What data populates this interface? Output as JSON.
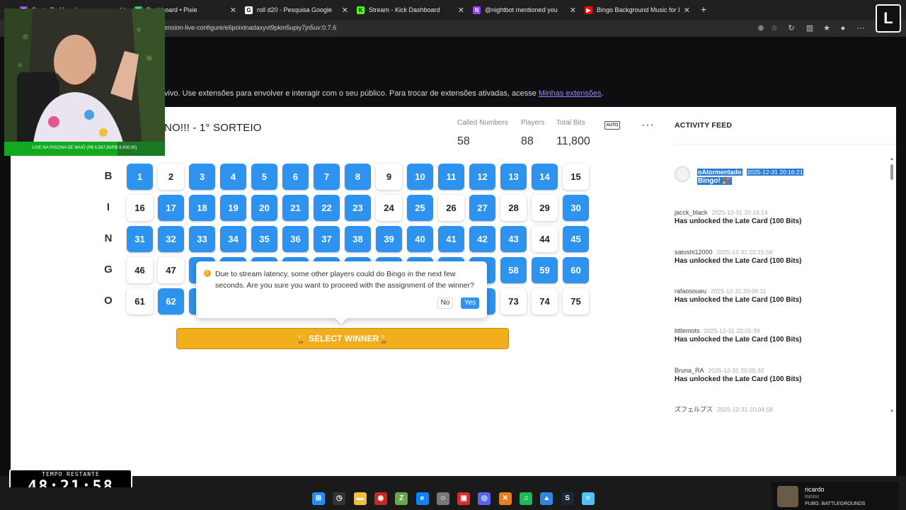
{
  "browser": {
    "tabs": [
      {
        "label": "Santa Pe Vaso Ia",
        "icon": "twitch-icon",
        "color": "#9146ff"
      },
      {
        "label": "Dashboard • Pixie",
        "icon": "pixie-icon",
        "color": "#22c55e"
      },
      {
        "label": "roll d20 - Pesquisa Google",
        "icon": "google-icon",
        "color": "#ffffff"
      },
      {
        "label": "Stream - Kick Dashboard",
        "icon": "kick-icon",
        "color": "#53fc18"
      },
      {
        "label": "@nightbot mentioned you",
        "icon": "nightbot-icon",
        "color": "#9146ff"
      },
      {
        "label": "Bingo Background Music for I",
        "icon": "youtube-icon",
        "color": "#ff0000"
      }
    ],
    "url": "ension-live-configure/e6poixtnadaxyvt9pkm5upiy7jn5uv:0.7.6"
  },
  "dashboard": {
    "subtitle_text": "vivo. Use extensões para envolver e interagir com o seu público. Para trocar de extensões ativadas, acesse ",
    "subtitle_link": "Minhas extensões",
    "subtitle_end": "."
  },
  "bingo": {
    "title": "NO!!! - 1° SORTEIO",
    "stats": [
      {
        "label": "Called Numbers",
        "value": "58"
      },
      {
        "label": "Players",
        "value": "88"
      },
      {
        "label": "Total Bits",
        "value": "11,800"
      }
    ],
    "auto_label": "AUTO",
    "more_label": "···",
    "rows": [
      {
        "letter": "B",
        "cells": [
          {
            "n": "1",
            "on": true
          },
          {
            "n": "2",
            "on": false
          },
          {
            "n": "3",
            "on": true
          },
          {
            "n": "4",
            "on": true
          },
          {
            "n": "5",
            "on": true
          },
          {
            "n": "6",
            "on": true
          },
          {
            "n": "7",
            "on": true
          },
          {
            "n": "8",
            "on": true
          },
          {
            "n": "9",
            "on": false
          },
          {
            "n": "10",
            "on": true
          },
          {
            "n": "11",
            "on": true
          },
          {
            "n": "12",
            "on": true
          },
          {
            "n": "13",
            "on": true
          },
          {
            "n": "14",
            "on": true
          },
          {
            "n": "15",
            "on": false
          }
        ]
      },
      {
        "letter": "I",
        "cells": [
          {
            "n": "16",
            "on": false
          },
          {
            "n": "17",
            "on": true
          },
          {
            "n": "18",
            "on": true
          },
          {
            "n": "19",
            "on": true
          },
          {
            "n": "20",
            "on": true
          },
          {
            "n": "21",
            "on": true
          },
          {
            "n": "22",
            "on": true
          },
          {
            "n": "23",
            "on": true
          },
          {
            "n": "24",
            "on": false
          },
          {
            "n": "25",
            "on": true
          },
          {
            "n": "26",
            "on": false
          },
          {
            "n": "27",
            "on": true
          },
          {
            "n": "28",
            "on": false
          },
          {
            "n": "29",
            "on": false
          },
          {
            "n": "30",
            "on": true
          }
        ]
      },
      {
        "letter": "N",
        "cells": [
          {
            "n": "31",
            "on": true
          },
          {
            "n": "32",
            "on": true
          },
          {
            "n": "33",
            "on": true
          },
          {
            "n": "34",
            "on": true
          },
          {
            "n": "35",
            "on": true
          },
          {
            "n": "36",
            "on": true
          },
          {
            "n": "37",
            "on": true
          },
          {
            "n": "38",
            "on": true
          },
          {
            "n": "39",
            "on": true
          },
          {
            "n": "40",
            "on": true
          },
          {
            "n": "41",
            "on": true
          },
          {
            "n": "42",
            "on": true
          },
          {
            "n": "43",
            "on": true
          },
          {
            "n": "44",
            "on": false
          },
          {
            "n": "45",
            "on": true
          }
        ]
      },
      {
        "letter": "G",
        "cells": [
          {
            "n": "46",
            "on": false
          },
          {
            "n": "47",
            "on": false
          },
          {
            "n": "",
            "on": true
          },
          {
            "n": "",
            "on": true
          },
          {
            "n": "",
            "on": true
          },
          {
            "n": "",
            "on": true
          },
          {
            "n": "",
            "on": true
          },
          {
            "n": "",
            "on": true
          },
          {
            "n": "",
            "on": true
          },
          {
            "n": "",
            "on": true
          },
          {
            "n": "",
            "on": true
          },
          {
            "n": "",
            "on": true
          },
          {
            "n": "58",
            "on": true
          },
          {
            "n": "59",
            "on": true
          },
          {
            "n": "60",
            "on": true
          }
        ]
      },
      {
        "letter": "O",
        "cells": [
          {
            "n": "61",
            "on": false
          },
          {
            "n": "62",
            "on": true
          },
          {
            "n": "",
            "on": true
          },
          {
            "n": "",
            "on": true
          },
          {
            "n": "",
            "on": true
          },
          {
            "n": "",
            "on": true
          },
          {
            "n": "",
            "on": true
          },
          {
            "n": "",
            "on": true
          },
          {
            "n": "",
            "on": true
          },
          {
            "n": "",
            "on": true
          },
          {
            "n": "",
            "on": true
          },
          {
            "n": "",
            "on": true
          },
          {
            "n": "73",
            "on": false
          },
          {
            "n": "74",
            "on": false
          },
          {
            "n": "75",
            "on": false
          }
        ]
      }
    ],
    "popover": {
      "message": "Due to stream latency, some other players could do Bingo in the next few seconds. Are you sure you want to proceed with the assignment of the winner?",
      "no_label": "No",
      "yes_label": "Yes"
    },
    "select_winner_label": "🏆 SELECT WINNER🏆"
  },
  "feed": {
    "title": "ACTIVITY FEED",
    "items": [
      {
        "user": "oAtormentado",
        "time": "2025-12-31 20:16:21",
        "message": "Bingo! 🎉",
        "highlight": true
      },
      {
        "user": "jacck_black",
        "time": "2025-12-31 20:16:14",
        "message": "Has unlocked the Late Card (100 Bits)",
        "highlight": false
      },
      {
        "user": "satoshi12000",
        "time": "2025-12-31 20:15:58",
        "message": "Has unlocked the Late Card (100 Bits)",
        "highlight": false
      },
      {
        "user": "rafaosoueu",
        "time": "2025-12-31 20:06:11",
        "message": "Has unlocked the Late Card (100 Bits)",
        "highlight": false
      },
      {
        "user": "littlemots",
        "time": "2025-12-31 20:05:39",
        "message": "Has unlocked the Late Card (100 Bits)",
        "highlight": false
      },
      {
        "user": "Bruna_RA",
        "time": "2025-12-31 20:05:32",
        "message": "Has unlocked the Late Card (100 Bits)",
        "highlight": false
      },
      {
        "user": "ズフェルプス",
        "time": "2025-12-31 20:04:58",
        "message": "",
        "highlight": false
      }
    ]
  },
  "overlay": {
    "cam_caption": "LIVE NA PISCINA DE MAIÔ (R$ 6.567,80/R$ 9.000,00)",
    "timer_label": "TEMPO RESTANTE",
    "timer_value": "48:21:58"
  },
  "notification": {
    "user": "ricardo",
    "action": "iniciou",
    "game": "PUBG: BATTLEGROUNDS"
  },
  "taskbar": {
    "icons": [
      "windows-icon",
      "clock-icon",
      "folder-icon",
      "app-red-icon",
      "app-green-icon",
      "edge-icon",
      "ghost-icon",
      "app-badge-icon",
      "discord-icon",
      "app-x-icon",
      "spotify-icon",
      "photos-icon",
      "steam-icon",
      "notepad-icon"
    ]
  },
  "colors": {
    "accent_blue": "#2d93ef",
    "select_winner": "#f0ad1c",
    "link": "#a77bff"
  }
}
